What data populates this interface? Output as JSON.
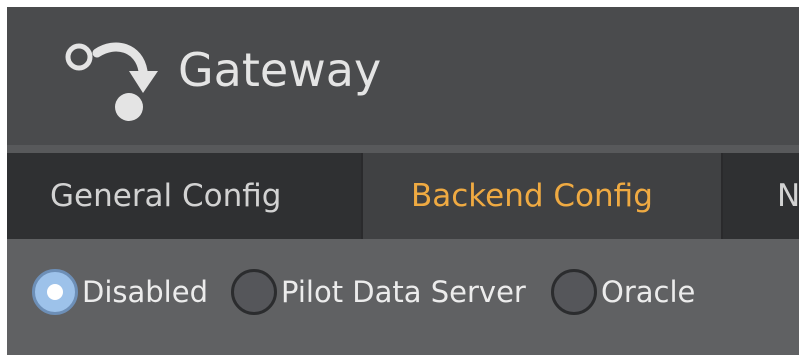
{
  "app": {
    "title": "Gateway",
    "icon": "gateway-icon"
  },
  "tabs": [
    {
      "label": "General Config",
      "active": false
    },
    {
      "label": "Backend Config",
      "active": true
    },
    {
      "label": "N",
      "active": false
    }
  ],
  "backend": {
    "options": [
      {
        "label": "Disabled",
        "selected": true
      },
      {
        "label": "Pilot Data Server",
        "selected": false
      },
      {
        "label": "Oracle",
        "selected": false
      }
    ]
  },
  "colors": {
    "titlebar": "#4a4b4d",
    "tabbar": "#3a3b3d",
    "active_tab_text": "#efaa42",
    "panel": "#606163",
    "radio_selected": "#9dc2ea"
  }
}
